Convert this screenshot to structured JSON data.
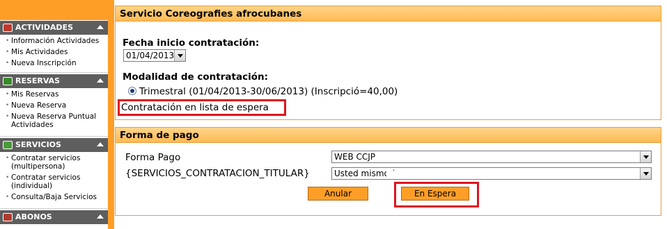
{
  "sidebar": {
    "sections": [
      {
        "title": "ACTIVIDADES",
        "icon": "calendar-icon",
        "color": "#c0392b",
        "items": [
          "Información Actividades",
          "Mis Actividades",
          "Nueva Inscripción"
        ]
      },
      {
        "title": "RESERVAS",
        "icon": "grid-icon",
        "color": "#3a8a2c",
        "items": [
          "Mis Reservas",
          "Nueva Reserva",
          "Nueva Reserva Puntual Actividades"
        ]
      },
      {
        "title": "SERVICIOS",
        "icon": "list-icon",
        "color": "#4a9a3a",
        "items": [
          "Contratar servicios (multipersona)",
          "Contratar servicios (individual)",
          "Consulta/Baja Servicios"
        ]
      },
      {
        "title": "ABONOS",
        "icon": "card-icon",
        "color": "#b03a2e",
        "items": []
      }
    ]
  },
  "servicio": {
    "title": "Servicio Coreografies afrocubanes",
    "fecha_label": "Fecha inicio contratación:",
    "fecha_value": "01/04/2013",
    "modalidad_label": "Modalidad de contratación:",
    "modalidad_option": "Trimestral (01/04/2013-30/06/2013) (Inscripció=40,00)",
    "espera_text": "Contratación en lista de espera"
  },
  "pago": {
    "title": "Forma de pago",
    "forma_label": "Forma Pago",
    "forma_value": "WEB CCJP",
    "titular_label": "{SERVICIOS_CONTRATACION_TITULAR}",
    "titular_value": "Usted mismo (",
    "anular_label": "Anular",
    "espera_button_label": "En Espera"
  },
  "colors": {
    "accent": "#ff9e26",
    "highlight": "#e0141e",
    "sidebar_header": "#5e5e5e"
  }
}
